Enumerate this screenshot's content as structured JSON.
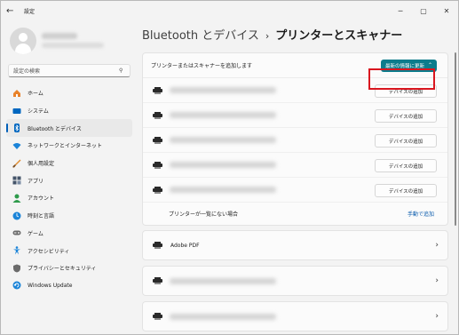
{
  "window": {
    "title": "設定",
    "controls": [
      "─",
      "▢",
      "✕"
    ]
  },
  "sidebar": {
    "search_placeholder": "設定の検索",
    "items": [
      {
        "label": "ホーム",
        "icon": "home-icon",
        "color": "#e8822a"
      },
      {
        "label": "システム",
        "icon": "system-icon",
        "color": "#0067c0"
      },
      {
        "label": "Bluetooth とデバイス",
        "icon": "bluetooth-icon",
        "color": "#0067c0",
        "active": true
      },
      {
        "label": "ネットワークとインターネット",
        "icon": "network-icon",
        "color": "#1b84d8"
      },
      {
        "label": "個人用設定",
        "icon": "brush-icon",
        "color": "#e08b2e"
      },
      {
        "label": "アプリ",
        "icon": "apps-icon",
        "color": "#44546a"
      },
      {
        "label": "アカウント",
        "icon": "account-icon",
        "color": "#2d9a4a"
      },
      {
        "label": "時刻と言語",
        "icon": "time-language-icon",
        "color": "#1b84d8"
      },
      {
        "label": "ゲーム",
        "icon": "game-icon",
        "color": "#6b6b6b"
      },
      {
        "label": "アクセシビリティ",
        "icon": "accessibility-icon",
        "color": "#1b84d8"
      },
      {
        "label": "プライバシーとセキュリティ",
        "icon": "shield-icon",
        "color": "#6b6b6b"
      },
      {
        "label": "Windows Update",
        "icon": "update-icon",
        "color": "#1b84d8"
      }
    ]
  },
  "main": {
    "breadcrumb": {
      "parent": "Bluetooth とデバイス",
      "separator": "›",
      "current": "プリンターとスキャナー"
    },
    "add_panel": {
      "label": "プリンターまたはスキャナーを追加します",
      "refresh_label": "最新の情報に更新",
      "refresh_color": "#0c7c8c",
      "add_device_label": "デバイスの追加",
      "device_count": 5,
      "not_listed": "プリンターが一覧にない場合",
      "manual_add": "手動で追加"
    },
    "printers": [
      {
        "name": "Adobe PDF"
      },
      {
        "name": ""
      },
      {
        "name": ""
      }
    ]
  },
  "highlight_color": "#d9161f"
}
